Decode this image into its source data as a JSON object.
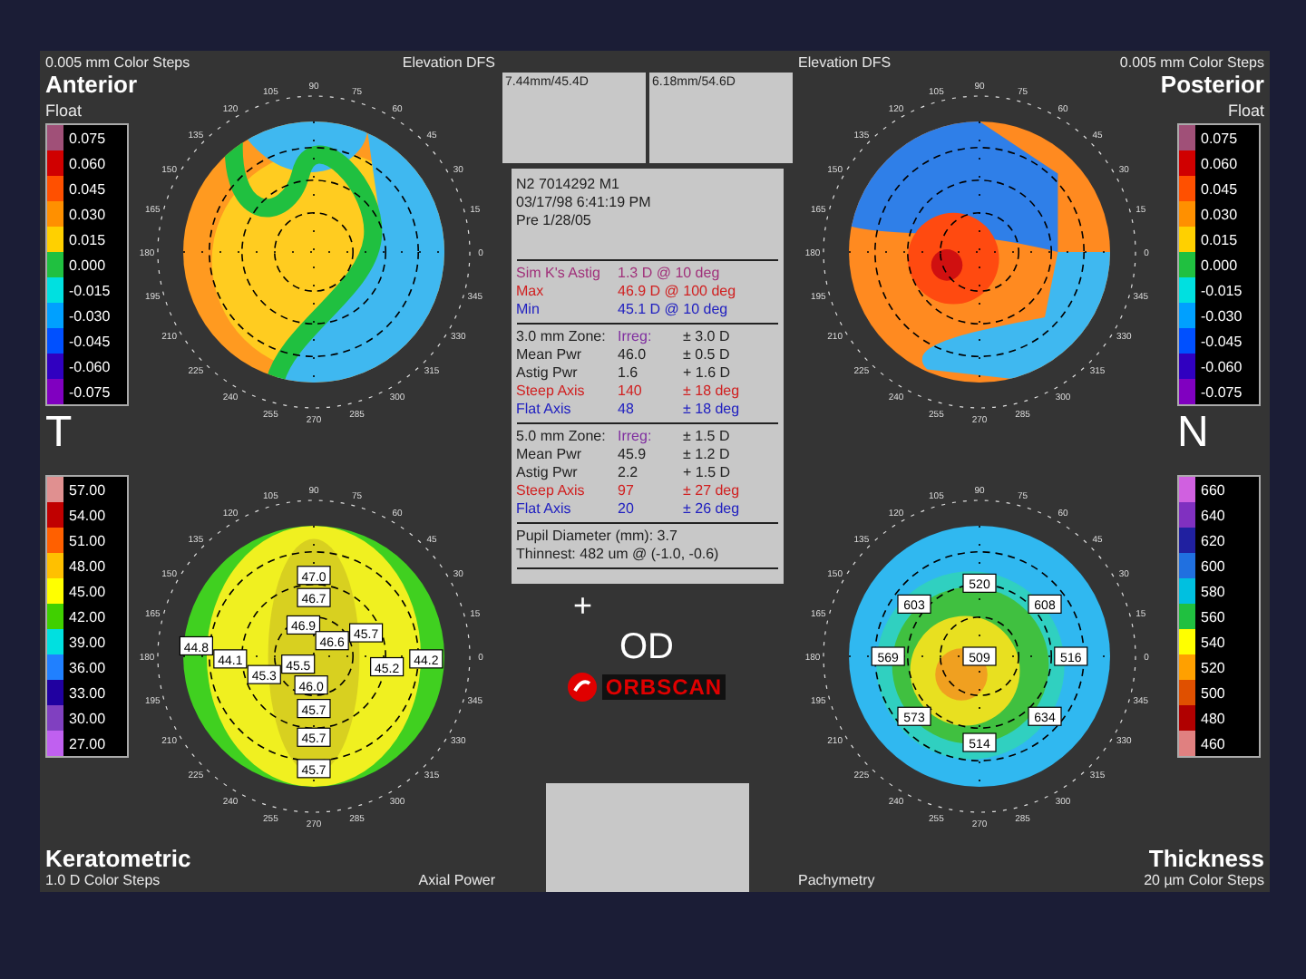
{
  "maps": [
    {
      "kind": "anterior",
      "caption": "0.005 mm Color Steps",
      "title": "Anterior",
      "subtitle": "Float",
      "map_type": "Elevation DFS",
      "orientation": "T",
      "scale": [
        {
          "label": "0.075",
          "color": "#a05078"
        },
        {
          "label": "0.060",
          "color": "#d00000"
        },
        {
          "label": "0.045",
          "color": "#ff5000"
        },
        {
          "label": "0.030",
          "color": "#ff9000"
        },
        {
          "label": "0.015",
          "color": "#ffd000"
        },
        {
          "label": "0.000",
          "color": "#20c040"
        },
        {
          "label": "-0.015",
          "color": "#00e0e0"
        },
        {
          "label": "-0.030",
          "color": "#00a0ff"
        },
        {
          "label": "-0.045",
          "color": "#0050ff"
        },
        {
          "label": "-0.060",
          "color": "#3000c0"
        },
        {
          "label": "-0.075",
          "color": "#8000c0"
        }
      ],
      "angle_labels": [
        "0",
        "15",
        "30",
        "45",
        "60",
        "75",
        "90",
        "105",
        "120",
        "135",
        "150",
        "165",
        "180",
        "195",
        "210",
        "225",
        "240",
        "255",
        "270",
        "285",
        "300",
        "315",
        "330",
        "345"
      ]
    },
    {
      "kind": "posterior",
      "caption": "0.005 mm Color Steps",
      "title": "Posterior",
      "subtitle": "Float",
      "map_type": "Elevation DFS",
      "orientation": "N",
      "scale": [
        {
          "label": "0.075",
          "color": "#a05078"
        },
        {
          "label": "0.060",
          "color": "#d00000"
        },
        {
          "label": "0.045",
          "color": "#ff5000"
        },
        {
          "label": "0.030",
          "color": "#ff9000"
        },
        {
          "label": "0.015",
          "color": "#ffd000"
        },
        {
          "label": "0.000",
          "color": "#20c040"
        },
        {
          "label": "-0.015",
          "color": "#00e0e0"
        },
        {
          "label": "-0.030",
          "color": "#00a0ff"
        },
        {
          "label": "-0.045",
          "color": "#0050ff"
        },
        {
          "label": "-0.060",
          "color": "#3000c0"
        },
        {
          "label": "-0.075",
          "color": "#8000c0"
        }
      ],
      "angle_labels": [
        "0",
        "15",
        "30",
        "45",
        "60",
        "75",
        "90",
        "105",
        "120",
        "135",
        "150",
        "165",
        "180",
        "195",
        "210",
        "225",
        "240",
        "255",
        "270",
        "285",
        "300",
        "315",
        "330",
        "345"
      ]
    },
    {
      "kind": "keratometric",
      "caption": "1.0 D Color Steps",
      "title": "Keratometric",
      "map_type": "Axial Power",
      "scale": [
        {
          "label": "57.00",
          "color": "#e09090"
        },
        {
          "label": "54.00",
          "color": "#c00000"
        },
        {
          "label": "51.00",
          "color": "#ff6000"
        },
        {
          "label": "48.00",
          "color": "#ffc000"
        },
        {
          "label": "45.00",
          "color": "#ffff00"
        },
        {
          "label": "42.00",
          "color": "#40d000"
        },
        {
          "label": "39.00",
          "color": "#00e0e0"
        },
        {
          "label": "36.00",
          "color": "#2080ff"
        },
        {
          "label": "33.00",
          "color": "#2000a0"
        },
        {
          "label": "30.00",
          "color": "#8040c0"
        },
        {
          "label": "27.00",
          "color": "#c060f0"
        }
      ],
      "angle_labels": [
        "0",
        "15",
        "30",
        "45",
        "60",
        "75",
        "90",
        "105",
        "120",
        "135",
        "150",
        "165",
        "180",
        "195",
        "210",
        "225",
        "240",
        "255",
        "270",
        "285",
        "300",
        "315",
        "330",
        "345"
      ],
      "value_labels": [
        "47.0",
        "46.7",
        "45.7",
        "46.9",
        "46.6",
        "45.5",
        "46.0",
        "45.3",
        "44.8",
        "44.1",
        "45.2",
        "44.2",
        "45.7",
        "45.7",
        "45.7"
      ]
    },
    {
      "kind": "pachymetry",
      "caption": "20 µm Color Steps",
      "title": "Thickness",
      "map_type": "Pachymetry",
      "scale": [
        {
          "label": "660",
          "color": "#d060e0"
        },
        {
          "label": "640",
          "color": "#8030c0"
        },
        {
          "label": "620",
          "color": "#2020a0"
        },
        {
          "label": "600",
          "color": "#2070e0"
        },
        {
          "label": "580",
          "color": "#00c0e0"
        },
        {
          "label": "560",
          "color": "#20c040"
        },
        {
          "label": "540",
          "color": "#ffff00"
        },
        {
          "label": "520",
          "color": "#ffa000"
        },
        {
          "label": "500",
          "color": "#e05000"
        },
        {
          "label": "480",
          "color": "#b00000"
        },
        {
          "label": "460",
          "color": "#e08080"
        }
      ],
      "angle_labels": [
        "0",
        "15",
        "30",
        "45",
        "60",
        "75",
        "90",
        "105",
        "120",
        "135",
        "150",
        "165",
        "180",
        "195",
        "210",
        "225",
        "240",
        "255",
        "270",
        "285",
        "300",
        "315",
        "330",
        "345"
      ],
      "value_labels": [
        "520",
        "603",
        "608",
        "569",
        "509",
        "516",
        "573",
        "634",
        "514"
      ]
    }
  ],
  "center": {
    "boxes": [
      "7.44mm/45.4D",
      "6.18mm/54.6D"
    ],
    "header": [
      "N2 7014292 M1",
      "03/17/98 6:41:19 PM",
      "Pre 1/28/05"
    ],
    "k_readings": [
      {
        "label": "Sim K's Astig",
        "value": "1.3 D @ 10 deg",
        "kind": "astig"
      },
      {
        "label": "Max",
        "value": "46.9 D @ 100 deg",
        "kind": "max"
      },
      {
        "label": "Min",
        "value": "45.1 D @ 10 deg",
        "kind": "min"
      }
    ],
    "zones": [
      {
        "title": "3.0 mm Zone:",
        "irreg_label": "Irreg:",
        "irreg": "± 3.0 D",
        "rows": [
          {
            "label": "Mean Pwr",
            "value": "46.0",
            "range": "± 0.5 D",
            "kind": "plain"
          },
          {
            "label": "Astig Pwr",
            "value": "1.6",
            "range": "+ 1.6 D",
            "kind": "plain"
          },
          {
            "label": "Steep Axis",
            "value": "140",
            "range": "± 18 deg",
            "kind": "steep"
          },
          {
            "label": "Flat Axis",
            "value": "48",
            "range": "± 18 deg",
            "kind": "flat"
          }
        ]
      },
      {
        "title": "5.0 mm Zone:",
        "irreg_label": "Irreg:",
        "irreg": "± 1.5 D",
        "rows": [
          {
            "label": "Mean Pwr",
            "value": "45.9",
            "range": "± 1.2 D",
            "kind": "plain"
          },
          {
            "label": "Astig Pwr",
            "value": "2.2",
            "range": "+ 1.5 D",
            "kind": "plain"
          },
          {
            "label": "Steep Axis",
            "value": "97",
            "range": "± 27 deg",
            "kind": "steep"
          },
          {
            "label": "Flat Axis",
            "value": "20",
            "range": "± 26 deg",
            "kind": "flat"
          }
        ]
      }
    ],
    "footer": [
      "Pupil Diameter (mm): 3.7",
      "Thinnest: 482 um @ (-1.0, -0.6)"
    ],
    "plus": "+",
    "eye": "OD",
    "logo": "ORBSCAN"
  }
}
